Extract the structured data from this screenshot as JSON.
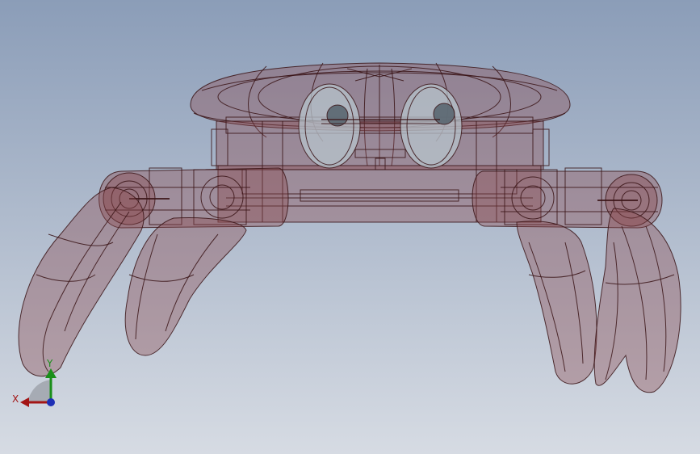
{
  "viewport": {
    "background_top": "#8b9db8",
    "background_bottom": "#d6dbe3",
    "model_fill": "#8c4a4e",
    "model_stroke": "#3a1416",
    "glass_fill": "#b7c4cc"
  },
  "triad": {
    "x_label": "X",
    "y_label": "Y",
    "x_color": "#a31515",
    "y_color": "#1a8f1a",
    "z_color": "#1d2fb5"
  }
}
